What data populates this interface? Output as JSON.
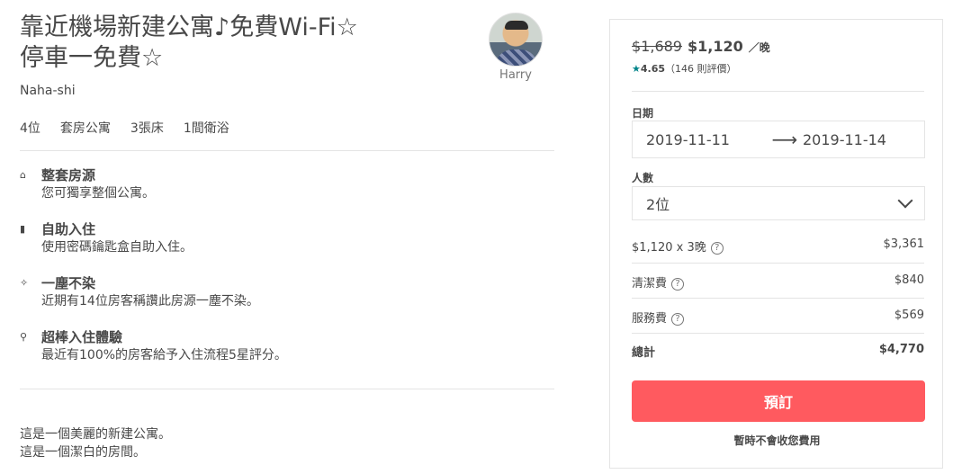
{
  "listing": {
    "title_line1": "靠近機場新建公寓♪免費Wi-Fi☆",
    "title_line2": "停車一免費☆",
    "location": "Naha-shi",
    "host_name": "Harry",
    "facts": [
      "4位",
      "套房公寓",
      "3張床",
      "1間衛浴"
    ]
  },
  "highlights": [
    {
      "icon": "home-icon",
      "glyph": "⌂",
      "title": "整套房源",
      "desc": "您可獨享整個公寓。"
    },
    {
      "icon": "door-icon",
      "glyph": "▮",
      "title": "自助入住",
      "desc": "使用密碼鑰匙盒自助入住。"
    },
    {
      "icon": "sparkle-icon",
      "glyph": "✧",
      "title": "一塵不染",
      "desc": "近期有14位房客稱讚此房源一塵不染。"
    },
    {
      "icon": "key-icon",
      "glyph": "⚲",
      "title": "超棒入住體驗",
      "desc": "最近有100%的房客給予入住流程5星評分。"
    }
  ],
  "description": {
    "line1": "這是一個美麗的新建公寓。",
    "line2": "這是一個潔白的房間。"
  },
  "booking": {
    "old_price": "$1,689",
    "new_price": "$1,120",
    "per_night": "／晚",
    "rating_star": "★",
    "rating_value": "4.65",
    "rating_count": "（146 則評價）",
    "dates_label": "日期",
    "checkin": "2019-11-11",
    "arrow": "⟶",
    "checkout": "2019-11-14",
    "guests_label": "人數",
    "guests_value": "2位",
    "lines": [
      {
        "label": "$1,120 x 3晚",
        "amount": "$3,361"
      },
      {
        "label": "清潔費",
        "amount": "$840"
      },
      {
        "label": "服務費",
        "amount": "$569"
      }
    ],
    "total_label": "總計",
    "total_amount": "$4,770",
    "book_button": "預訂",
    "note": "暫時不會收您費用"
  },
  "colors": {
    "accent": "#ff5a5f",
    "star": "#008489",
    "text": "#484848",
    "border": "#e4e4e4"
  }
}
